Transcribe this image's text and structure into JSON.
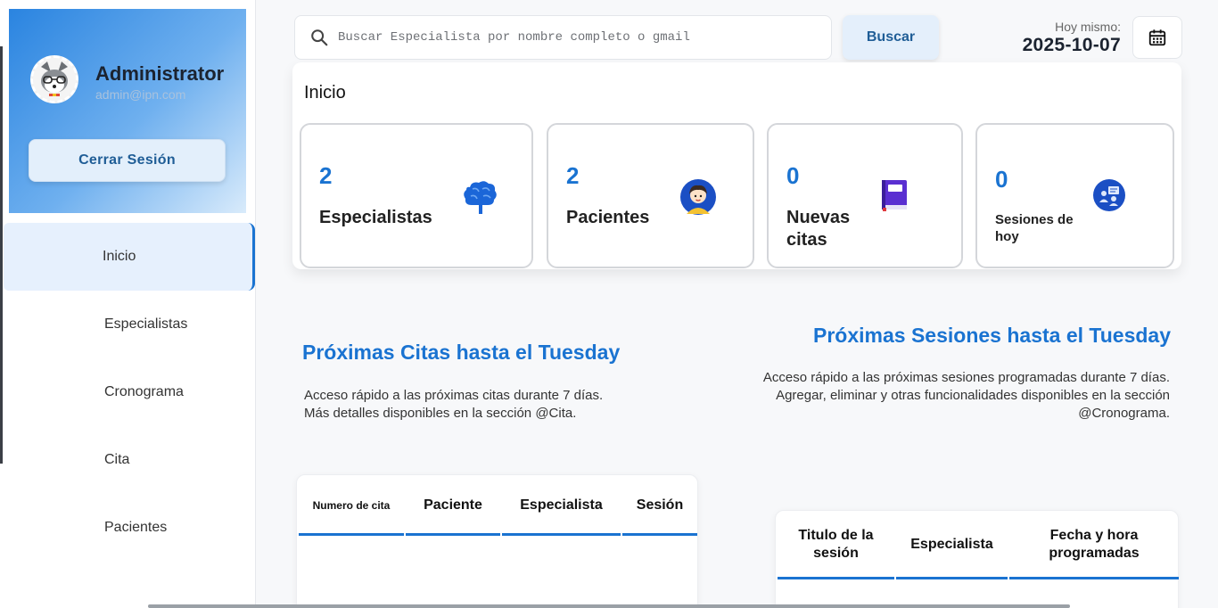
{
  "sidebar": {
    "profile": {
      "name": "Administrator",
      "email": "admin@ipn.com"
    },
    "logout_label": "Cerrar Sesión",
    "items": [
      {
        "label": "Inicio"
      },
      {
        "label": "Especialistas"
      },
      {
        "label": "Cronograma"
      },
      {
        "label": "Cita"
      },
      {
        "label": "Pacientes"
      }
    ]
  },
  "header": {
    "search_placeholder": "Buscar Especialista por nombre completo o gmail",
    "search_button": "Buscar",
    "date_label": "Hoy mismo:",
    "date_value": "2025-10-07",
    "calendar_icon": "calendar-icon"
  },
  "dashboard": {
    "title": "Inicio",
    "cards": [
      {
        "value": "2",
        "label": "Especialistas",
        "icon": "brain-icon"
      },
      {
        "value": "2",
        "label": "Pacientes",
        "icon": "patient-icon"
      },
      {
        "value": "0",
        "label": "Nuevas citas",
        "icon": "book-icon"
      },
      {
        "value": "0",
        "label": "Sesiones de hoy",
        "icon": "session-icon"
      }
    ]
  },
  "appointments": {
    "title": "Próximas Citas hasta el Tuesday",
    "desc_line1": "Acceso rápido a las próximas citas durante 7 días.",
    "desc_line2": "Más detalles disponibles en la sección @Cita.",
    "columns": [
      "Numero de cita",
      "Paciente",
      "Especialista",
      "Sesión"
    ]
  },
  "sessions": {
    "title": "Próximas Sesiones hasta el Tuesday",
    "desc_line1": "Acceso rápido a las próximas sesiones programadas durante 7 días.",
    "desc_line2": "Agregar, eliminar y otras funcionalidades disponibles en la sección @Cronograma.",
    "columns": [
      "Titulo de la sesión",
      "Especialista",
      "Fecha y hora programadas"
    ]
  },
  "colors": {
    "accent": "#1a73d1",
    "active_bg": "#e6f0fd"
  }
}
